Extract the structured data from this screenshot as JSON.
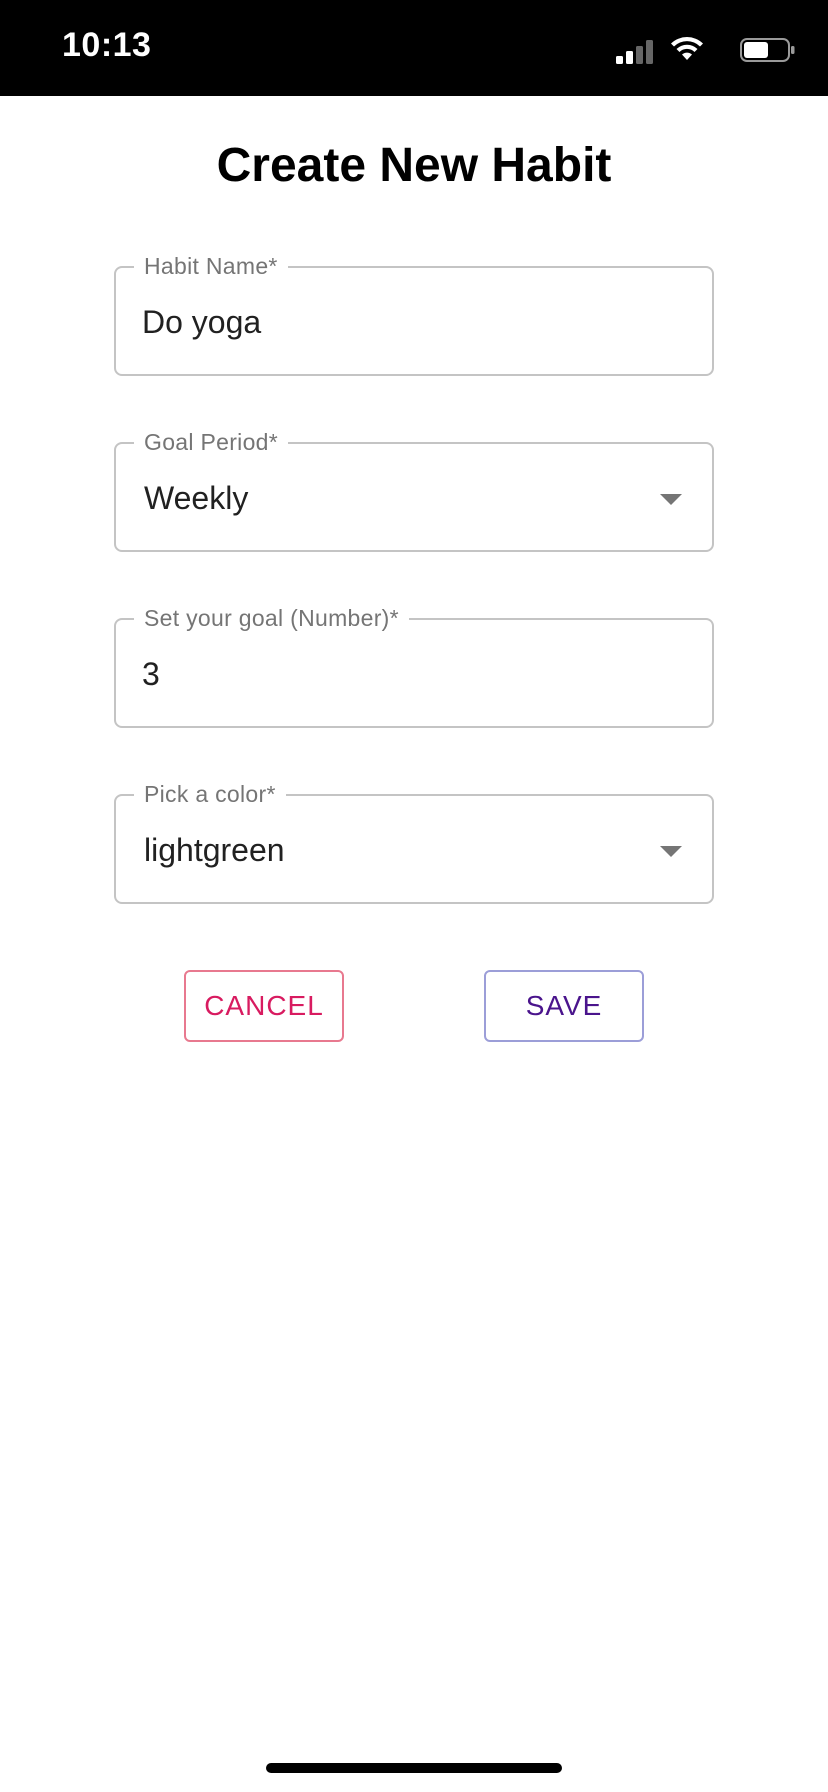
{
  "status_bar": {
    "time": "10:13",
    "icons": [
      "signal-icon",
      "wifi-icon",
      "battery-icon"
    ]
  },
  "page": {
    "title": "Create New Habit"
  },
  "form": {
    "habit_name": {
      "label": "Habit Name*",
      "value": "Do yoga"
    },
    "goal_period": {
      "label": "Goal Period*",
      "value": "Weekly"
    },
    "goal_number": {
      "label": "Set your goal (Number)*",
      "value": "3"
    },
    "color": {
      "label": "Pick a color*",
      "value": "lightgreen"
    }
  },
  "actions": {
    "cancel_label": "CANCEL",
    "save_label": "SAVE"
  },
  "colors": {
    "cancel": "#d81b60",
    "save": "#4a148c",
    "status_bar_bg": "#000000"
  }
}
